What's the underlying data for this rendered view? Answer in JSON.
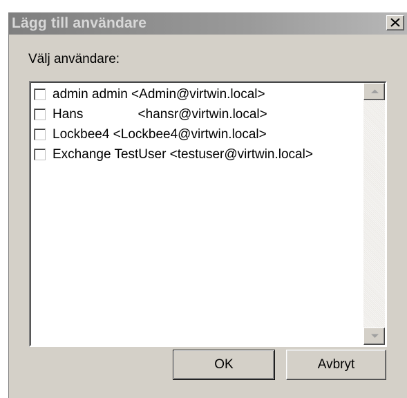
{
  "dialog": {
    "title": "Lägg till användare",
    "prompt": "Välj användare:",
    "ok_label": "OK",
    "cancel_label": "Avbryt"
  },
  "user_list": {
    "items": [
      {
        "label": "admin admin <Admin@virtwin.local>",
        "checked": false
      },
      {
        "label": "Hans               <hansr@virtwin.local>",
        "checked": false
      },
      {
        "label": "Lockbee4 <Lockbee4@virtwin.local>",
        "checked": false
      },
      {
        "label": "Exchange TestUser <testuser@virtwin.local>",
        "checked": false
      }
    ]
  },
  "icons": {
    "close": "close-icon",
    "scroll_up": "scroll-up-arrow-icon",
    "scroll_down": "scroll-down-arrow-icon"
  },
  "colors": {
    "dialog_face": "#d4d0c8",
    "titlebar_inactive": "#8a8a8a",
    "list_background": "#ffffff"
  }
}
